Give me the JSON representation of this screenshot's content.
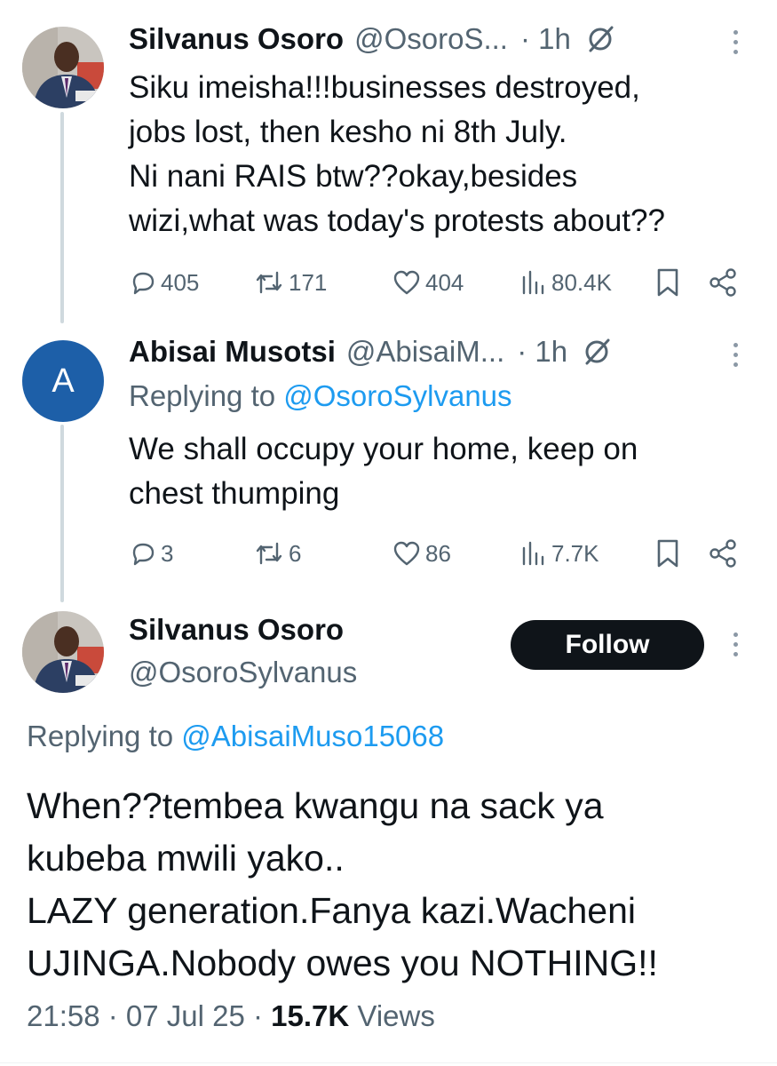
{
  "tweet1": {
    "name": "Silvanus Osoro",
    "handle": "@OsoroS...",
    "time": "· 1h",
    "text": "Siku imeisha!!!businesses destroyed,\njobs lost, then kesho ni 8th July.\nNi nani RAIS btw??okay,besides\nwizi,what was today's protests about??",
    "replies": "405",
    "reposts": "171",
    "likes": "404",
    "views": "80.4K"
  },
  "tweet2": {
    "avatar_letter": "A",
    "name": "Abisai Musotsi",
    "handle": "@AbisaiM...",
    "time": "· 1h",
    "replying_prefix": "Replying to ",
    "replying_to": "@OsoroSylvanus",
    "text": "We shall occupy your home, keep on\nchest thumping",
    "replies": "3",
    "reposts": "6",
    "likes": "86",
    "views": "7.7K"
  },
  "main_tweet": {
    "name": "Silvanus Osoro",
    "handle": "@OsoroSylvanus",
    "follow_label": "Follow",
    "replying_prefix": "Replying to ",
    "replying_to": "@AbisaiMuso15068",
    "text": "When??tembea kwangu na sack ya\nkubeba mwili yako..\nLAZY generation.Fanya kazi.Wacheni\nUJINGA.Nobody owes you NOTHING!!",
    "timestamp": "21:58 · 07 Jul 25 · ",
    "views_count": "15.7K",
    "views_label": " Views"
  },
  "colors": {
    "accent": "#1d9bf0",
    "text_primary": "#0f1419",
    "text_secondary": "#536471",
    "avatar_letter_bg": "#1d5fa8"
  },
  "icons": [
    "reply-icon",
    "repost-icon",
    "like-icon",
    "views-icon",
    "bookmark-icon",
    "share-icon",
    "more-icon",
    "grok-slash-icon"
  ]
}
